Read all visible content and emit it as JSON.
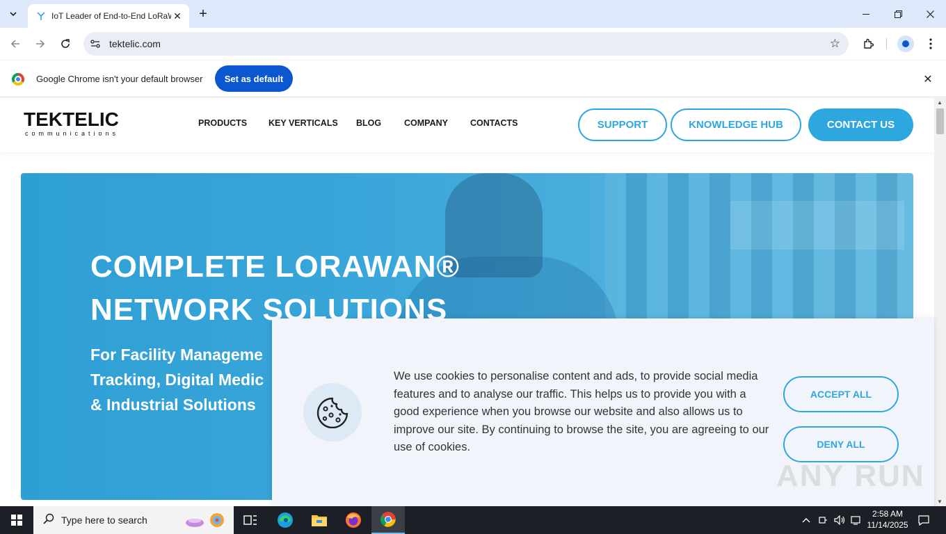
{
  "browser": {
    "tab_title": "IoT Leader of End-to-End LoRaWAN",
    "url": "tektelic.com",
    "infobar_text": "Google Chrome isn't your default browser",
    "infobar_button": "Set as default"
  },
  "site": {
    "logo_main": "TEKTELIC",
    "logo_sub": "communications",
    "nav": [
      "PRODUCTS",
      "KEY VERTICALS",
      "BLOG",
      "COMPANY",
      "CONTACTS"
    ],
    "support": "SUPPORT",
    "knowledge_hub": "KNOWLEDGE HUB",
    "contact_us": "CONTACT US"
  },
  "hero": {
    "title_line1": "COMPLETE LORAWAN®",
    "title_line2": "NETWORK SOLUTIONS",
    "sub_line1": "For Facility Manageme",
    "sub_line2": "Tracking, Digital Medic",
    "sub_line3": "& Industrial Solutions"
  },
  "cookie": {
    "text": "We use cookies to personalise content and ads, to provide social media features and to analyse our traffic. This helps us to provide you with a good experience when you browse our website and also allows us to improve our site. By continuing to browse the site, you are agreeing to our use of cookies.",
    "accept": "ACCEPT ALL",
    "deny": "DENY ALL"
  },
  "watermark": "ANY RUN",
  "taskbar": {
    "search_placeholder": "Type here to search",
    "time": "2:58 AM",
    "date": "11/14/2025"
  },
  "colors": {
    "brand_blue": "#2ea7df",
    "chrome_blue": "#0b57d0",
    "taskbar": "#1c2026"
  }
}
